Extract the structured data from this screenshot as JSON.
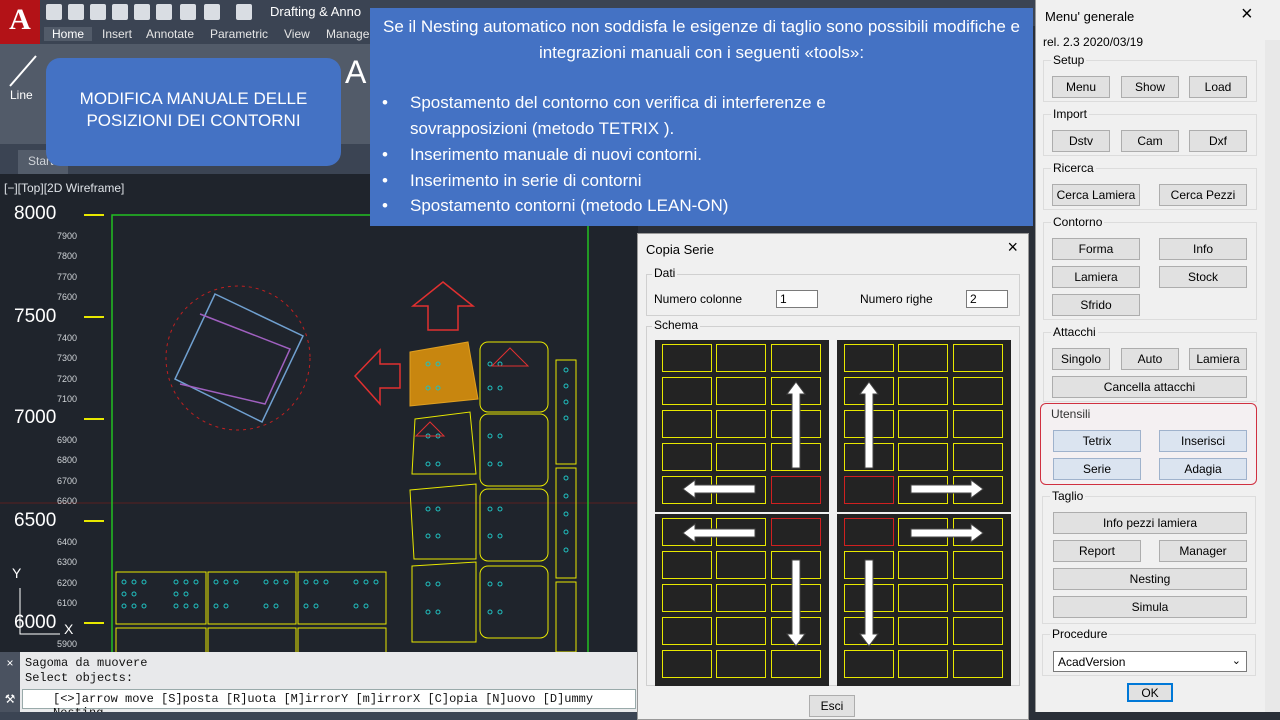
{
  "app": {
    "workspace": "Drafting & Anno",
    "ribbon_tabs": [
      "Home",
      "Insert",
      "Annotate",
      "Parametric",
      "View",
      "Manage"
    ],
    "ribbon_line": "Line",
    "start_tab": "Start",
    "viewport_label": "[−][Top][2D Wireframe]",
    "y_big": [
      "8000",
      "7500",
      "7000",
      "6500",
      "6000"
    ],
    "y_small": [
      "7900",
      "7800",
      "7700",
      "7600",
      "7400",
      "7300",
      "7200",
      "7100",
      "6900",
      "6800",
      "6700",
      "6600",
      "6400",
      "6300",
      "6200",
      "6100",
      "5900"
    ],
    "cmd_lines": [
      "Sagoma da muovere",
      "Select objects:"
    ],
    "cmd_input": "[<>]arrow move [S]posta [R]uota [M]irrorY [m]irrorX [C]opia [N]uovo [D]ummy Nesting"
  },
  "callout_left": {
    "text": "MODIFICA MANUALE DELLE POSIZIONI DEI CONTORNI"
  },
  "callout_top": {
    "title": "Se il Nesting automatico non soddisfa le esigenze di taglio sono possibili modifiche e integrazioni manuali con i seguenti «tools»:",
    "bullets": [
      "Spostamento del contorno con verifica di interferenze  e",
      "sovrapposizioni (metodo TETRIX ).",
      "Inserimento  manuale di nuovi contorni.",
      "Inserimento  in serie di contorni",
      "Spostamento contorni (metodo LEAN-ON)"
    ]
  },
  "dialog": {
    "title": "Copia Serie",
    "close": "×",
    "group_dati": "Dati",
    "label_colonne": "Numero colonne",
    "value_colonne": "1",
    "label_righe": "Numero righe",
    "value_righe": "2",
    "group_schema": "Schema",
    "exit_button": "Esci"
  },
  "menu": {
    "title": "Menu' generale",
    "close": "×",
    "version": "rel. 2.3 2020/03/19",
    "groups": {
      "setup": {
        "label": "Setup",
        "buttons": [
          "Menu",
          "Show",
          "Load"
        ]
      },
      "import": {
        "label": "Import",
        "buttons": [
          "Dstv",
          "Cam",
          "Dxf"
        ]
      },
      "ricerca": {
        "label": "Ricerca",
        "buttons": [
          "Cerca Lamiera",
          "Cerca Pezzi"
        ]
      },
      "contorno": {
        "label": "Contorno",
        "buttons": [
          "Forma",
          "Info",
          "Lamiera",
          "Stock",
          "Sfrido"
        ]
      },
      "attacchi": {
        "label": "Attacchi",
        "buttons": [
          "Singolo",
          "Auto",
          "Lamiera",
          "Cancella attacchi"
        ]
      },
      "utensili": {
        "label": "Utensili",
        "buttons": [
          "Tetrix",
          "Inserisci",
          "Serie",
          "Adagia"
        ]
      },
      "taglio": {
        "label": "Taglio",
        "buttons": [
          "Info pezzi lamiera",
          "Report",
          "Manager",
          "Nesting",
          "Simula"
        ]
      },
      "procedure": {
        "label": "Procedure",
        "select": "AcadVersion"
      }
    },
    "ok": "OK"
  }
}
